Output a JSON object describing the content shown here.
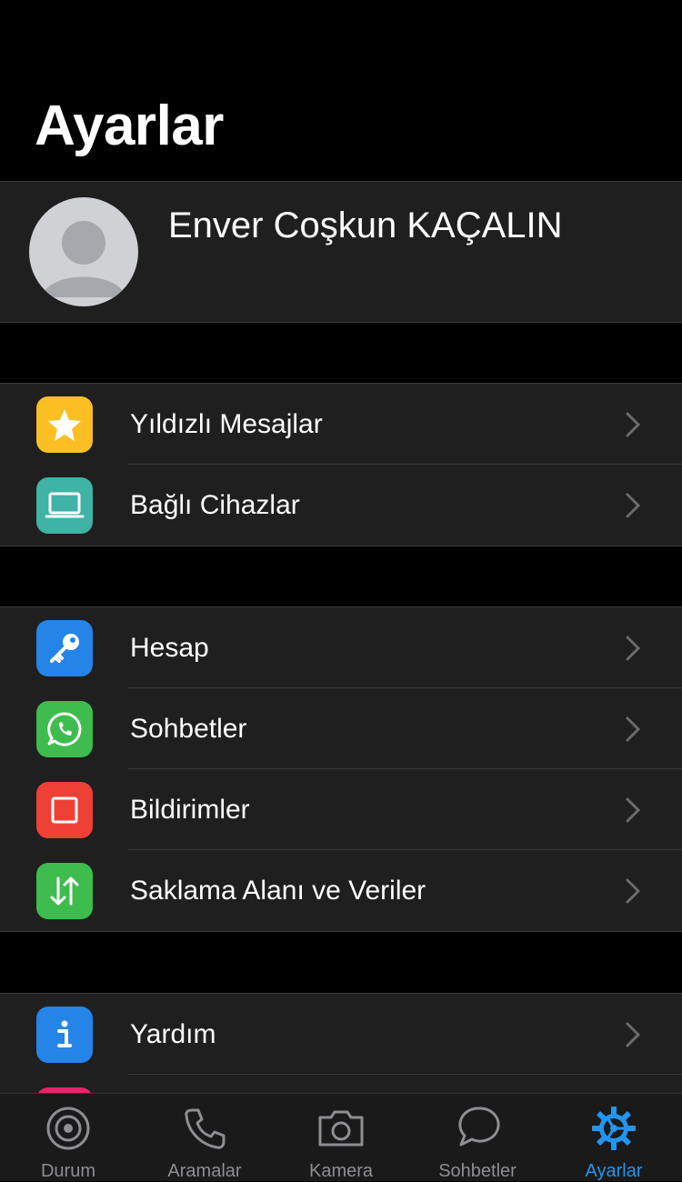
{
  "header": {
    "title": "Ayarlar"
  },
  "profile": {
    "name": "Enver Coşkun KAÇALIN"
  },
  "groups": [
    {
      "items": [
        {
          "label": "Yıldızlı Mesajlar",
          "icon": "star-icon",
          "color": "#fbbf24"
        },
        {
          "label": "Bağlı Cihazlar",
          "icon": "laptop-icon",
          "color": "#3fb3a5"
        }
      ]
    },
    {
      "items": [
        {
          "label": "Hesap",
          "icon": "key-icon",
          "color": "#2584e8"
        },
        {
          "label": "Sohbetler",
          "icon": "whatsapp-icon",
          "color": "#3ebd4e"
        },
        {
          "label": "Bildirimler",
          "icon": "notification-icon",
          "color": "#ef4036"
        },
        {
          "label": "Saklama Alanı ve Veriler",
          "icon": "data-arrows-icon",
          "color": "#3ebd4e"
        }
      ]
    },
    {
      "items": [
        {
          "label": "Yardım",
          "icon": "info-icon",
          "color": "#2584e8"
        }
      ]
    }
  ],
  "tabbar": {
    "tabs": [
      {
        "label": "Durum",
        "icon": "status-icon"
      },
      {
        "label": "Aramalar",
        "icon": "phone-icon"
      },
      {
        "label": "Kamera",
        "icon": "camera-icon"
      },
      {
        "label": "Sohbetler",
        "icon": "chat-bubble-icon"
      },
      {
        "label": "Ayarlar",
        "icon": "gear-icon",
        "active": true
      }
    ],
    "accent_color": "#2196f3"
  }
}
